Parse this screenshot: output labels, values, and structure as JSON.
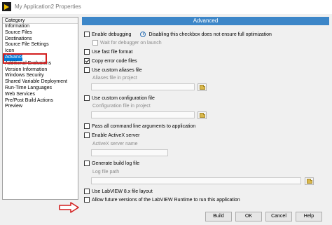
{
  "window": {
    "title": "My Application2 Properties",
    "icon": "labview-app-icon"
  },
  "category": {
    "header": "Category",
    "items": [
      "Information",
      "Source Files",
      "Destinations",
      "Source File Settings",
      "Icon",
      "Advanced",
      "Additional Exclusions",
      "Version Information",
      "Windows Security",
      "Shared Variable Deployment",
      "Run-Time Languages",
      "Web Services",
      "Pre/Post Build Actions",
      "Preview"
    ],
    "selected": "Advanced"
  },
  "panel": {
    "header": "Advanced",
    "enable_debugging": {
      "label": "Enable debugging",
      "checked": false
    },
    "debug_info": "Disabling this checkbox does not ensure full optimization",
    "wait_debugger": {
      "label": "Wait for debugger on launch",
      "checked": false,
      "disabled": true
    },
    "fast_file_format": {
      "label": "Use fast file format",
      "checked": false
    },
    "copy_error_code": {
      "label": "Copy error code files",
      "checked": true
    },
    "custom_aliases": {
      "label": "Use custom aliases file",
      "checked": false
    },
    "aliases_file_label": "Aliases file in project",
    "custom_config": {
      "label": "Use custom configuration file",
      "checked": false
    },
    "config_file_label": "Configuration file in project",
    "pass_cmd_args": {
      "label": "Pass all command line arguments to application",
      "checked": false
    },
    "activex": {
      "label": "Enable ActiveX server",
      "checked": false
    },
    "activex_name_label": "ActiveX server name",
    "build_log": {
      "label": "Generate build log file",
      "checked": false
    },
    "log_path_label": "Log file path",
    "labview8x": {
      "label": "Use LabVIEW 8.x file layout",
      "checked": false
    },
    "future_runtime": {
      "label": "Allow future versions of the LabVIEW Runtime to run this application",
      "checked": false
    }
  },
  "buttons": {
    "build": "Build",
    "ok": "OK",
    "cancel": "Cancel",
    "help": "Help"
  },
  "colors": {
    "selection": "#0078d7",
    "header": "#3c86c8",
    "annotation": "#d31f1f"
  }
}
